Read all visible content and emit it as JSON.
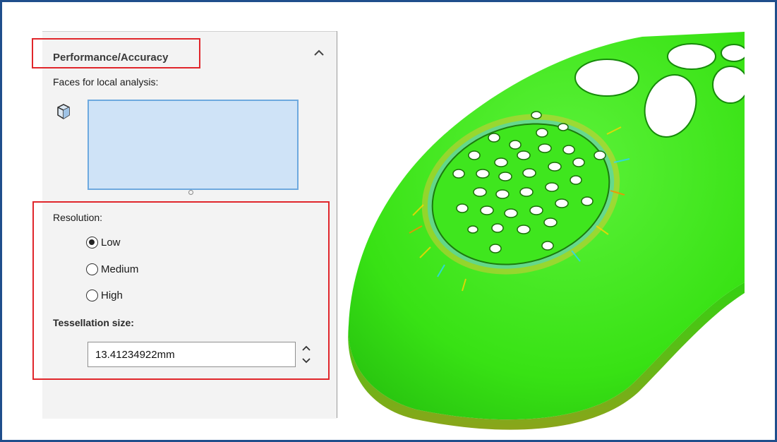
{
  "section": {
    "title": "Performance/Accuracy",
    "collapse_icon": "chevron-up-icon"
  },
  "faces": {
    "label": "Faces for local analysis:",
    "icon": "face-selection-cube-icon"
  },
  "resolution": {
    "label": "Resolution:",
    "options": [
      {
        "label": "Low",
        "checked": true
      },
      {
        "label": "Medium",
        "checked": false
      },
      {
        "label": "High",
        "checked": false
      }
    ]
  },
  "tessellation": {
    "label": "Tessellation size:",
    "value": "13.41234922mm"
  },
  "colors": {
    "highlight": "#e0262b",
    "selection_fill": "#cfe3f7",
    "model_green": "#3ee61c",
    "frame_border": "#1f4e8c"
  }
}
